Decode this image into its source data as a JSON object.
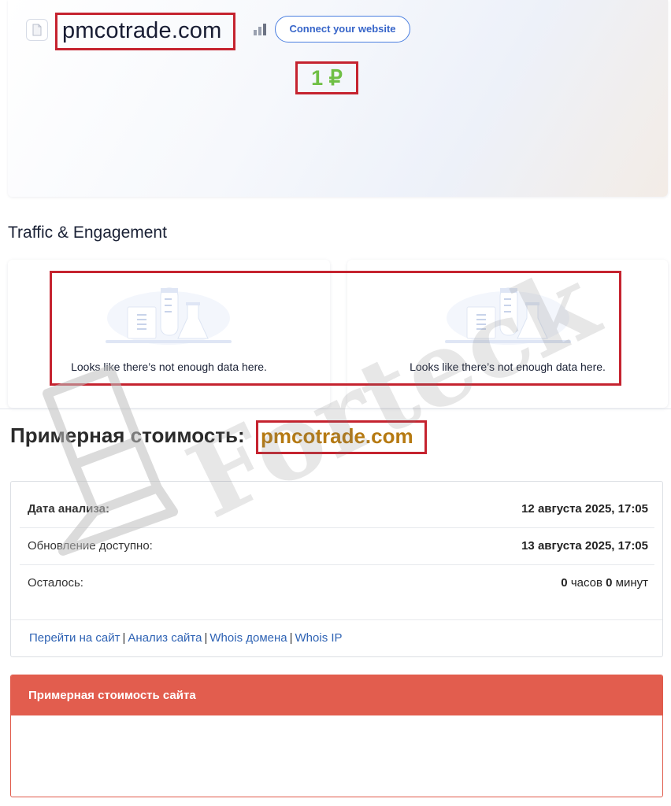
{
  "header": {
    "domain": "pmcotrade.com",
    "connect_label": "Connect your website"
  },
  "traffic": {
    "title": "Traffic & Engagement",
    "panels": [
      {
        "message": "Looks like there’s not enough data here."
      },
      {
        "message": "Looks like there’s not enough data here."
      }
    ]
  },
  "cost_section": {
    "heading": "Примерная стоимость:",
    "domain": "pmcotrade.com",
    "rows": [
      {
        "label": "Дата анализа:",
        "value": "12 августа 2025, 17:05"
      },
      {
        "label": "Обновление доступно:",
        "value": "13 августа 2025, 17:05"
      },
      {
        "label": "Осталось:",
        "hours": "0",
        "hours_unit": "часов",
        "minutes": "0",
        "minutes_unit": "минут"
      }
    ],
    "links": [
      "Перейти на сайт",
      "Анализ сайта",
      "Whois домена",
      "Whois IP"
    ],
    "separator": "|"
  },
  "price": {
    "header": "Примерная стоимость сайта",
    "value": "1 ₽"
  },
  "watermark": {
    "text": "Forteck"
  },
  "colors": {
    "highlight": "#c5232f",
    "accent_blue": "#3765c9",
    "domain_gold": "#b67a12",
    "price_header": "#e25d4e",
    "price_green": "#6fbf45"
  }
}
